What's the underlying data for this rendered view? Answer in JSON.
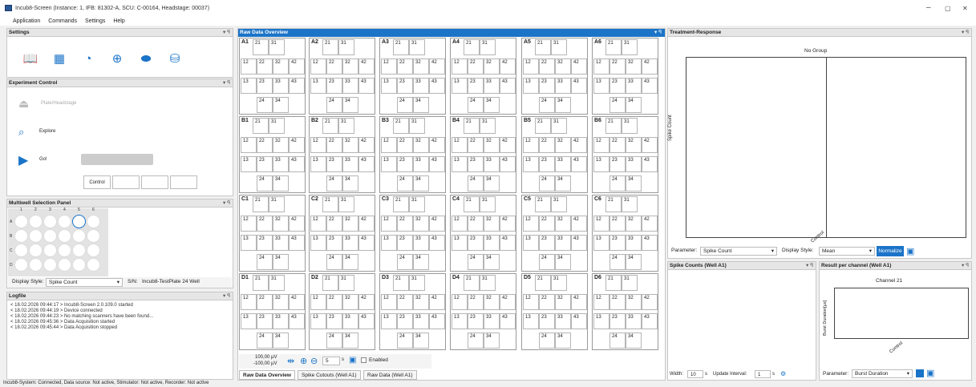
{
  "window": {
    "title": "Incub8-Screen (Instance: 1, IFB: 81302-A, SCU: C-00164, Headstage: 00037)",
    "min": "–",
    "max": "▢",
    "close": "✕"
  },
  "menu": [
    "Application",
    "Commands",
    "Settings",
    "Help"
  ],
  "settings": {
    "title": "Settings",
    "icons": [
      "book-icon",
      "grid-icon",
      "pie-chart-icon",
      "zoom-icon",
      "eraser-icon",
      "database-icon"
    ]
  },
  "experiment": {
    "title": "Experiment Control",
    "plate": "Plate/Headstage",
    "explore": "Explore",
    "go": "Go!",
    "control": "Control"
  },
  "multiwell": {
    "title": "Multiwell Selection Panel",
    "cols": [
      "1",
      "2",
      "3",
      "4",
      "5",
      "6"
    ],
    "rows": [
      "A",
      "B",
      "C",
      "D"
    ],
    "display_label": "Display Style:",
    "display_value": "Spike Count",
    "sn_label": "S/N:",
    "sn_value": "Incub8-TestPlate 24 Well"
  },
  "logfile": {
    "title": "Logfile",
    "lines": [
      "< 18.02.2026 09:44:17 > Incub8-Screen 2.0.109.0 started",
      "< 18.02.2026 09:44:19 > Device connected",
      "< 18.02.2026 09:44:23 > No matching scanners have been found...",
      "< 18.02.2026 09:45:36 > Data Acquisition started",
      "< 18.02.2026 09:45:44 > Data Acquisition stopped"
    ]
  },
  "raw": {
    "title": "Raw Data Overview",
    "wells": [
      [
        "A1",
        "A2",
        "A3",
        "A4",
        "A5",
        "A6"
      ],
      [
        "B1",
        "B2",
        "B3",
        "B4",
        "B5",
        "B6"
      ],
      [
        "C1",
        "C2",
        "C3",
        "C4",
        "C5",
        "C6"
      ],
      [
        "D1",
        "D2",
        "D3",
        "D4",
        "D5",
        "D6"
      ]
    ],
    "channels": [
      [
        "21",
        "31"
      ],
      [
        "12",
        "22",
        "32",
        "42"
      ],
      [
        "13",
        "23",
        "33",
        "43"
      ],
      [
        "24",
        "34"
      ]
    ],
    "scale_top": "100,00 µV",
    "scale_bot": "-100,00 µV",
    "time": "5",
    "unit": "s",
    "enabled": "Enabled",
    "tabs": [
      "Raw Data Overview",
      "Spike Cutouts (Well A1)",
      "Raw Data (Well A1)"
    ]
  },
  "treatment": {
    "title": "Treatment-Response",
    "plot_title": "No Group",
    "ylabel": "Spike Count",
    "xtick": "Control",
    "param_label": "Parameter:",
    "param_value": "Spike Count",
    "display_label": "Display Style:",
    "display_value": "Mean",
    "normalize": "Normalize"
  },
  "spikecounts": {
    "title": "Spike Counts (Well A1)",
    "width_label": "Width:",
    "width_value": "10",
    "unit": "s",
    "interval_label": "Update Interval:",
    "interval_value": "1"
  },
  "result": {
    "title": "Result per channel (Well A1)",
    "plot_title": "Channel 21",
    "ylabel": "Burst Duration[µs]",
    "xtick": "Control",
    "param_label": "Parameter:",
    "param_value": "Burst Duration"
  },
  "status": "Incub8-System: Connected, Data source: Not active, Stimulator: Not active, Recorder: Not active"
}
